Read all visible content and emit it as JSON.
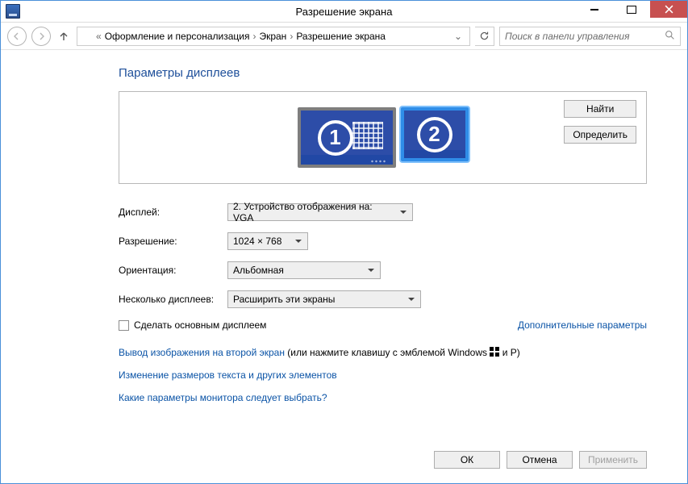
{
  "window": {
    "title": "Разрешение экрана"
  },
  "breadcrumbs": {
    "cat": "Оформление и персонализация",
    "screen": "Экран",
    "page": "Разрешение экрана"
  },
  "search": {
    "placeholder": "Поиск в панели управления"
  },
  "section_title": "Параметры дисплеев",
  "preview": {
    "mon1": "1",
    "mon2": "2",
    "find_btn": "Найти",
    "identify_btn": "Определить"
  },
  "form": {
    "display_label": "Дисплей:",
    "display_value": "2. Устройство отображения на: VGA",
    "resolution_label": "Разрешение:",
    "resolution_value": "1024 × 768",
    "orientation_label": "Ориентация:",
    "orientation_value": "Альбомная",
    "multi_label": "Несколько дисплеев:",
    "multi_value": "Расширить эти экраны"
  },
  "checkbox_label": "Сделать основным дисплеем",
  "advanced_link": "Дополнительные параметры",
  "project_pre": "Вывод изображения на второй экран",
  "project_post_a": " (или нажмите клавишу с эмблемой Windows ",
  "project_post_b": " и P)",
  "resize_link": "Изменение размеров текста и других элементов",
  "help_link": "Какие параметры монитора следует выбрать?",
  "footer": {
    "ok": "ОК",
    "cancel": "Отмена",
    "apply": "Применить"
  }
}
